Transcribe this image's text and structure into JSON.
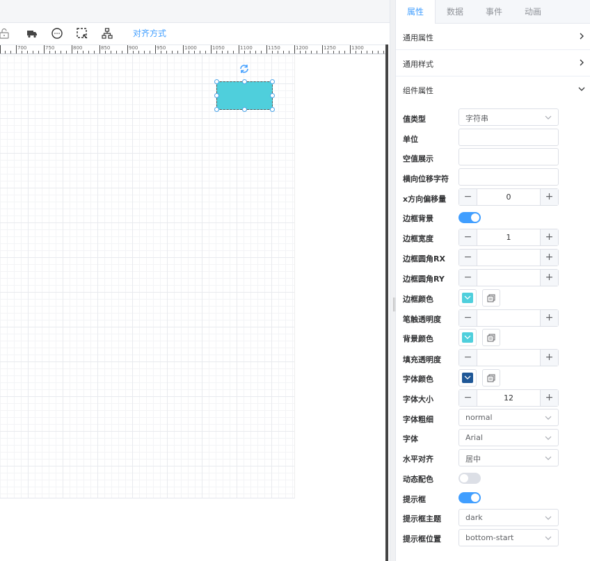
{
  "toolbar": {
    "align_label": "对齐方式"
  },
  "ruler": {
    "labels": [
      "700",
      "750",
      "800",
      "850",
      "900",
      "950",
      "1000",
      "1050",
      "1100",
      "1150",
      "1200",
      "1250",
      "1300"
    ]
  },
  "shape": {
    "fill_color": "#4fcfdc"
  },
  "panel": {
    "tabs": [
      {
        "label": "属性",
        "active": true
      },
      {
        "label": "数据",
        "active": false
      },
      {
        "label": "事件",
        "active": false
      },
      {
        "label": "动画",
        "active": false
      }
    ],
    "sections": [
      {
        "label": "通用属性",
        "expanded": false
      },
      {
        "label": "通用样式",
        "expanded": false
      },
      {
        "label": "组件属性",
        "expanded": true
      }
    ],
    "props": {
      "value_type": {
        "label": "值类型",
        "value": "字符串"
      },
      "unit": {
        "label": "单位",
        "value": ""
      },
      "empty_display": {
        "label": "空值展示",
        "value": ""
      },
      "h_offset_char": {
        "label": "横向位移字符",
        "value": ""
      },
      "x_offset": {
        "label": "x方向偏移量",
        "value": "0"
      },
      "border_bg": {
        "label": "边框背景",
        "on": true
      },
      "border_width": {
        "label": "边框宽度",
        "value": "1"
      },
      "border_rx": {
        "label": "边框圆角RX",
        "value": ""
      },
      "border_ry": {
        "label": "边框圆角RY",
        "value": ""
      },
      "border_color": {
        "label": "边框颜色",
        "color": "#4fcfdc"
      },
      "stroke_opacity": {
        "label": "笔触透明度",
        "value": ""
      },
      "bg_color": {
        "label": "背景颜色",
        "color": "#4fcfdc"
      },
      "fill_opacity": {
        "label": "填充透明度",
        "value": ""
      },
      "font_color": {
        "label": "字体颜色",
        "color": "#1f5796"
      },
      "font_size": {
        "label": "字体大小",
        "value": "12"
      },
      "font_weight": {
        "label": "字体粗细",
        "value": "normal"
      },
      "font_family": {
        "label": "字体",
        "value": "Arial"
      },
      "h_align": {
        "label": "水平对齐",
        "value": "居中"
      },
      "dynamic_color": {
        "label": "动态配色",
        "on": false
      },
      "tooltip": {
        "label": "提示框",
        "on": true
      },
      "tooltip_theme": {
        "label": "提示框主题",
        "value": "dark"
      },
      "tooltip_position": {
        "label": "提示框位置",
        "value": "bottom-start"
      }
    }
  },
  "colors": {
    "accent": "#409eff",
    "switch_on": "#409eff",
    "switch_off": "#dcdfe6"
  }
}
